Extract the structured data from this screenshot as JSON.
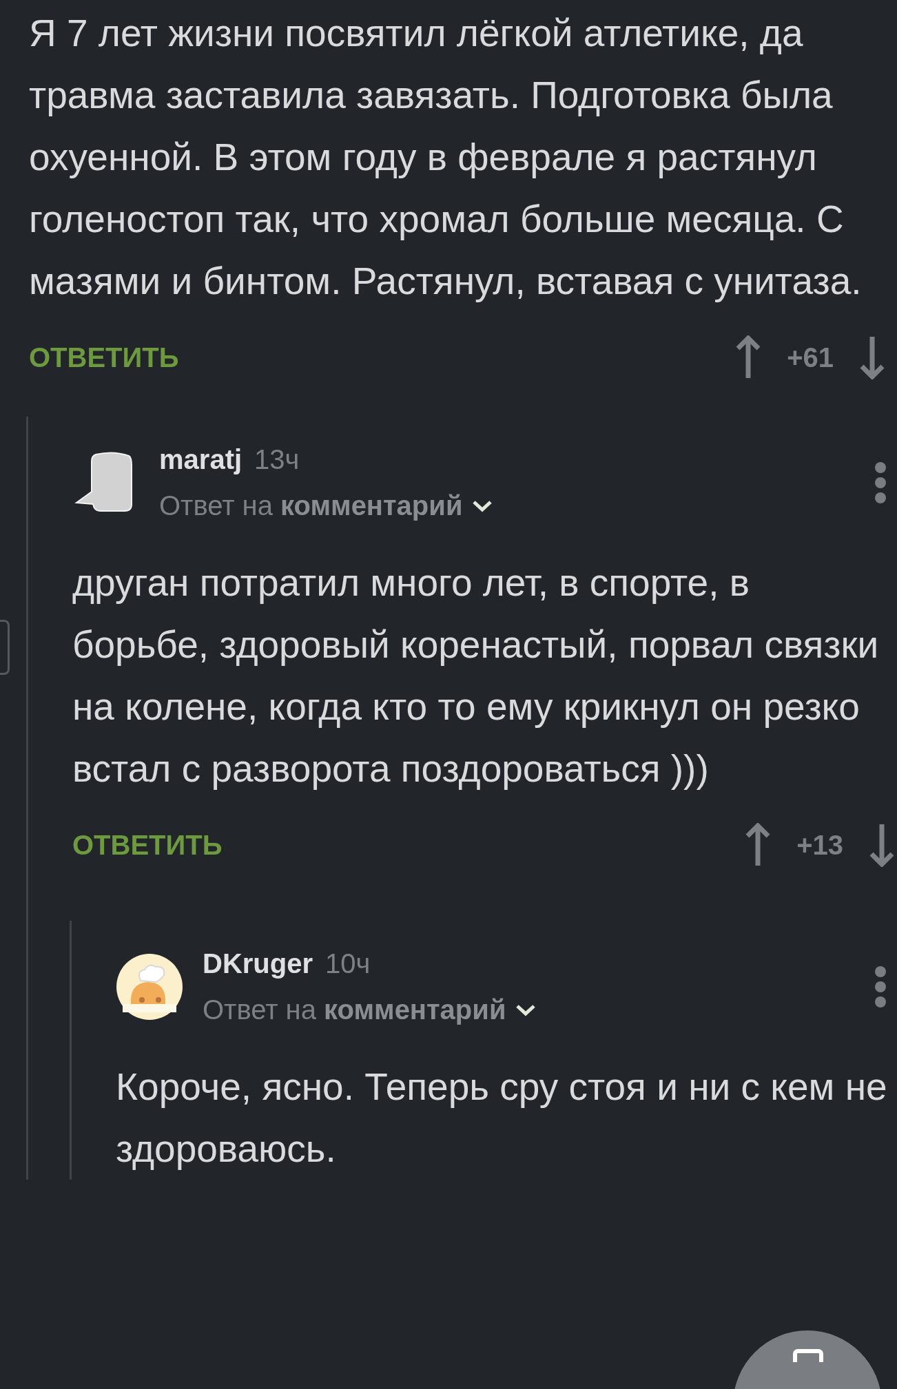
{
  "comment": {
    "text": "Я 7 лет жизни посвятил лёгкой атлетике, да травма заставила завязать. Подготовка была охуенной. В этом году в феврале я растянул голеностоп так, что хромал больше месяца. С мазями и бинтом. Растянул, вставая с унитаза.",
    "reply_label": "ОТВЕТИТЬ",
    "rating": "+61"
  },
  "replies": [
    {
      "author": "maratj",
      "time": "13ч",
      "reply_prefix": "Ответ на",
      "reply_target": "комментарий",
      "kind": "bubble",
      "text": "друган потратил много лет, в спорте, в борьбе, здоровый коренастый, порвал связки на колене, когда кто то ему крикнул он резко встал с разворота поздороваться )))",
      "reply_label": "ОТВЕТИТЬ",
      "rating": "+13"
    },
    {
      "author": "DKruger",
      "time": "10ч",
      "reply_prefix": "Ответ на",
      "reply_target": "комментарий",
      "kind": "chef",
      "text": "Короче, ясно. Теперь сру стоя и ни с кем не здороваюсь."
    }
  ]
}
